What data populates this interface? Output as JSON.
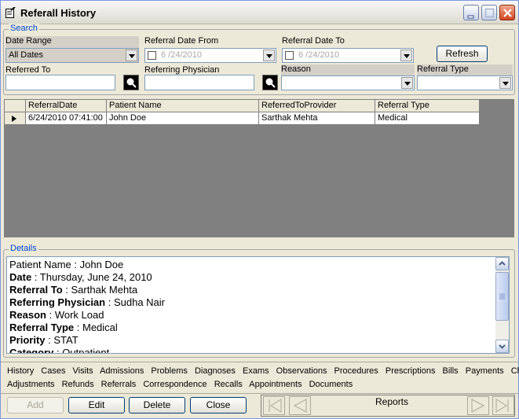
{
  "window": {
    "title": "Referall History"
  },
  "search": {
    "legend": "Search",
    "date_range_label": "Date Range",
    "date_range_value": "All Dates",
    "date_from_label": "Referral Date From",
    "date_from_value": "6 /24/2010",
    "date_to_label": "Referral Date To",
    "date_to_value": "6 /24/2010",
    "refresh_label": "Refresh",
    "referred_to_label": "Referred To",
    "referring_physician_label": "Referring Physician",
    "reason_label": "Reason",
    "referral_type_label": "Referral Type"
  },
  "grid": {
    "columns": [
      "ReferralDate",
      "Patient Name",
      "ReferredToProvider",
      "Referral Type"
    ],
    "rows": [
      [
        "6/24/2010 07:41:00",
        "John   Doe",
        "Sarthak Mehta",
        "Medical"
      ]
    ]
  },
  "details": {
    "legend": "Details",
    "lines": [
      {
        "label": "Patient Name",
        "sep": "  : ",
        "value": "John   Doe",
        "bold": false
      },
      {
        "label": "Date",
        "sep": " : ",
        "value": "Thursday, June 24, 2010",
        "bold": true
      },
      {
        "label": "Referral To",
        "sep": " : ",
        "value": "Sarthak Mehta",
        "bold": true
      },
      {
        "label": "Referring Physician",
        "sep": " : ",
        "value": "Sudha Nair",
        "bold": true
      },
      {
        "label": "Reason",
        "sep": " : ",
        "value": "Work Load",
        "bold": true
      },
      {
        "label": "Referral Type",
        "sep": "  : ",
        "value": "Medical",
        "bold": true
      },
      {
        "label": "Priority",
        "sep": " : ",
        "value": "STAT",
        "bold": true
      },
      {
        "label": "Category",
        "sep": "  : ",
        "value": "Outpatient",
        "bold": true
      }
    ]
  },
  "nav_links_row1": [
    "History",
    "Cases",
    "Visits",
    "Admissions",
    "Problems",
    "Diagnoses",
    "Exams",
    "Observations",
    "Procedures",
    "Prescriptions",
    "Bills",
    "Payments",
    "Charges"
  ],
  "nav_links_row2": [
    "Adjustments",
    "Refunds",
    "Referrals",
    "Correspondence",
    "Recalls",
    "Appointments",
    "Documents"
  ],
  "buttons": {
    "add": "Add",
    "edit": "Edit",
    "delete": "Delete",
    "close": "Close",
    "reports": "Reports"
  },
  "icons": {
    "title": "form-icon",
    "lookup": "magnifier-icon",
    "first": "first-record-icon",
    "prev": "previous-record-icon",
    "next": "next-record-icon",
    "last": "last-record-icon"
  },
  "colors": {
    "legend": "#0046d5",
    "close_button": "#d1451e"
  }
}
